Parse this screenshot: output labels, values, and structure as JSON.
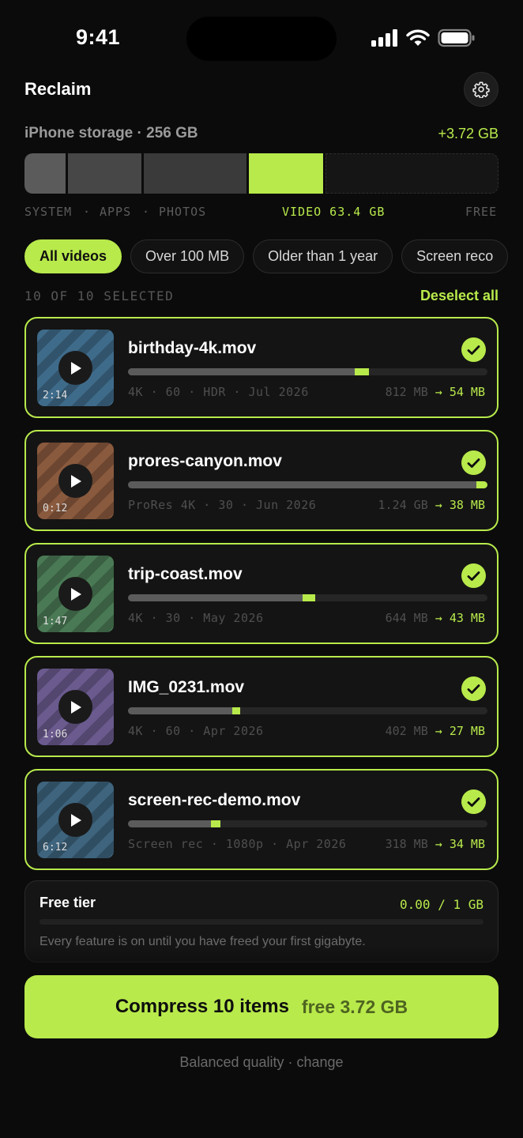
{
  "status_bar": {
    "time": "9:41",
    "icons": [
      "cellular-signal-icon",
      "wifi-icon",
      "battery-icon"
    ]
  },
  "header": {
    "title": "Reclaim",
    "settings_icon": "gear-icon"
  },
  "storage": {
    "label": "iPhone storage · 256 GB",
    "gain": "+3.72 GB",
    "legend": {
      "system": "SYSTEM",
      "apps": "APPS",
      "photos": "PHOTOS",
      "video": "VIDEO 63.4 GB",
      "free": "FREE"
    },
    "sep": "·"
  },
  "filters": {
    "chips": [
      {
        "label": "All videos",
        "active": true
      },
      {
        "label": "Over 100 MB",
        "active": false
      },
      {
        "label": "Older than 1 year",
        "active": false
      },
      {
        "label": "Screen reco",
        "active": false
      }
    ]
  },
  "selection": {
    "count_text": "10 OF 10 SELECTED",
    "deselect_label": "Deselect all"
  },
  "items": [
    {
      "name": "birthday-4k.mov",
      "duration": "2:14",
      "meta": "4K · 60 · HDR · Jul 2026",
      "from": "812 MB",
      "arrow": "→",
      "to": "54 MB",
      "selected": true,
      "fill": 0.63,
      "saved_fill": 0.04,
      "thumb_color": "#3f6b8a"
    },
    {
      "name": "prores-canyon.mov",
      "duration": "0:12",
      "meta": "ProRes 4K · 30 · Jun 2026",
      "from": "1.24 GB",
      "arrow": "→",
      "to": "38 MB",
      "selected": true,
      "fill": 0.97,
      "saved_fill": 0.03,
      "thumb_color": "#8a5a3e"
    },
    {
      "name": "trip-coast.mov",
      "duration": "1:47",
      "meta": "4K · 30 · May 2026",
      "from": "644 MB",
      "arrow": "→",
      "to": "43 MB",
      "selected": true,
      "fill": 0.485,
      "saved_fill": 0.035,
      "thumb_color": "#4a7a55"
    },
    {
      "name": "IMG_0231.mov",
      "duration": "1:06",
      "meta": "4K · 60 · Apr 2026",
      "from": "402 MB",
      "arrow": "→",
      "to": "27 MB",
      "selected": true,
      "fill": 0.29,
      "saved_fill": 0.022,
      "thumb_color": "#6a5a8e"
    },
    {
      "name": "screen-rec-demo.mov",
      "duration": "6:12",
      "meta": "Screen rec · 1080p · Apr 2026",
      "from": "318 MB",
      "arrow": "→",
      "to": "34 MB",
      "selected": true,
      "fill": 0.23,
      "saved_fill": 0.027,
      "thumb_color": "#3e647e"
    }
  ],
  "free_tier": {
    "title": "Free tier",
    "value": "0.00 / 1 GB",
    "note": "Every feature is on until you have freed your first gigabyte.",
    "fill": 0
  },
  "cta": {
    "label": "Compress 10 items",
    "sub": "free 3.72 GB"
  },
  "footnote": "Balanced quality · change",
  "colors": {
    "accent": "#b8ea4b",
    "background": "#0b0b0b",
    "card": "#141414"
  }
}
